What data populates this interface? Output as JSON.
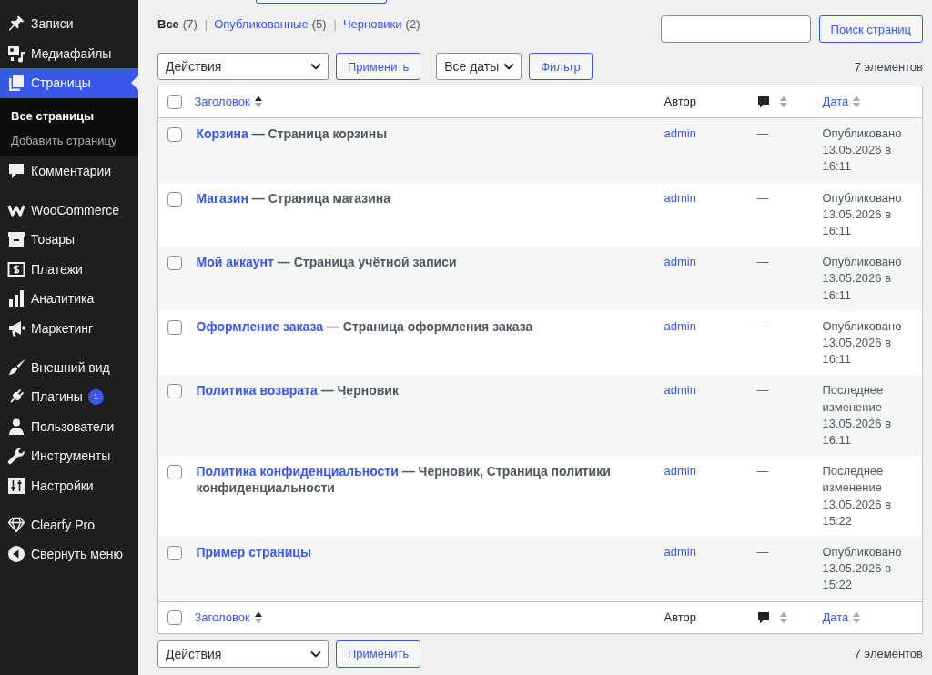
{
  "sidebar": {
    "sections": [
      {
        "items": [
          {
            "label": "Записи",
            "selected": false
          },
          {
            "label": "Медиафайлы",
            "selected": false
          },
          {
            "label": "Страницы",
            "selected": true,
            "children": [
              {
                "label": "Все страницы",
                "selected": true
              },
              {
                "label": "Добавить страницу",
                "selected": false
              }
            ]
          },
          {
            "label": "Комментарии",
            "selected": false
          }
        ]
      },
      {
        "items": [
          {
            "label": "WooCommerce",
            "selected": false
          },
          {
            "label": "Товары",
            "selected": false
          },
          {
            "label": "Платежи",
            "selected": false
          },
          {
            "label": "Аналитика",
            "selected": false
          },
          {
            "label": "Маркетинг",
            "selected": false
          }
        ]
      },
      {
        "items": [
          {
            "label": "Внешний вид",
            "selected": false
          },
          {
            "label": "Плагины",
            "selected": false,
            "badge": "1"
          },
          {
            "label": "Пользователи",
            "selected": false
          },
          {
            "label": "Инструменты",
            "selected": false
          },
          {
            "label": "Настройки",
            "selected": false
          }
        ]
      },
      {
        "items": [
          {
            "label": "Clearfy Pro",
            "selected": false
          }
        ]
      }
    ],
    "collapse_button": {
      "label": "Свернуть меню"
    }
  },
  "filters": [
    {
      "label": "Все",
      "count": "(7)",
      "selected": true,
      "separator": "|"
    },
    {
      "label": "Опубликованные",
      "count": "(5)",
      "selected": false,
      "separator": "|"
    },
    {
      "label": "Черновики",
      "count": "(2)",
      "selected": false
    }
  ],
  "search": {
    "button": "Поиск страниц"
  },
  "top_nav": {
    "bulk_action": "Действия",
    "apply": "Применить",
    "date_filter": "Все даты",
    "filter": "Фильтр",
    "count": "7 элементов"
  },
  "table": {
    "header": {
      "checked": false,
      "columns": [
        {
          "label": "Заголовок",
          "kind": "link",
          "sortable": true,
          "sorted": true
        },
        {
          "label": "Автор",
          "kind": "text",
          "sortable": false
        },
        {
          "kind": "comments",
          "sortable": true,
          "sorted": false
        },
        {
          "label": "Дата",
          "kind": "link",
          "sortable": true,
          "sorted": false
        }
      ]
    },
    "rows": [
      {
        "checked": false,
        "title": "Корзина",
        "state": "— Страница корзины",
        "author": "admin",
        "comments": "—",
        "status": "Опубликовано",
        "date": "13.05.2026 в 16:11"
      },
      {
        "checked": false,
        "title": "Магазин",
        "state": "— Страница магазина",
        "author": "admin",
        "comments": "—",
        "status": "Опубликовано",
        "date": "13.05.2026 в 16:11"
      },
      {
        "checked": false,
        "title": "Мой аккаунт",
        "state": "— Страница учётной записи",
        "author": "admin",
        "comments": "—",
        "status": "Опубликовано",
        "date": "13.05.2026 в 16:11"
      },
      {
        "checked": false,
        "title": "Оформление заказа",
        "state": "— Страница оформления заказа",
        "author": "admin",
        "comments": "—",
        "status": "Опубликовано",
        "date": "13.05.2026 в 16:11"
      },
      {
        "checked": false,
        "title": "Политика возврата",
        "state": "— Черновик",
        "author": "admin",
        "comments": "—",
        "status": "Последнее изменение",
        "date": "13.05.2026 в 16:11"
      },
      {
        "checked": false,
        "title": "Политика конфиденциальности",
        "state": "— Черновик, Страница политики конфиденциальности",
        "author": "admin",
        "comments": "—",
        "status": "Последнее изменение",
        "date": "13.05.2026 в 15:22"
      },
      {
        "checked": false,
        "title": "Пример страницы",
        "author": "admin",
        "comments": "—",
        "status": "Опубликовано",
        "date": "13.05.2026 в 15:22"
      }
    ],
    "footer": {
      "checked": false,
      "columns": [
        {
          "label": "Заголовок",
          "kind": "link",
          "sortable": true,
          "sorted": true
        },
        {
          "label": "Автор",
          "kind": "text",
          "sortable": false
        },
        {
          "kind": "comments",
          "sortable": true,
          "sorted": false
        },
        {
          "label": "Дата",
          "kind": "link",
          "sortable": true,
          "sorted": false
        }
      ]
    }
  },
  "bottom_nav": {
    "bulk_action": "Действия",
    "apply": "Применить",
    "count": "7 элементов"
  }
}
